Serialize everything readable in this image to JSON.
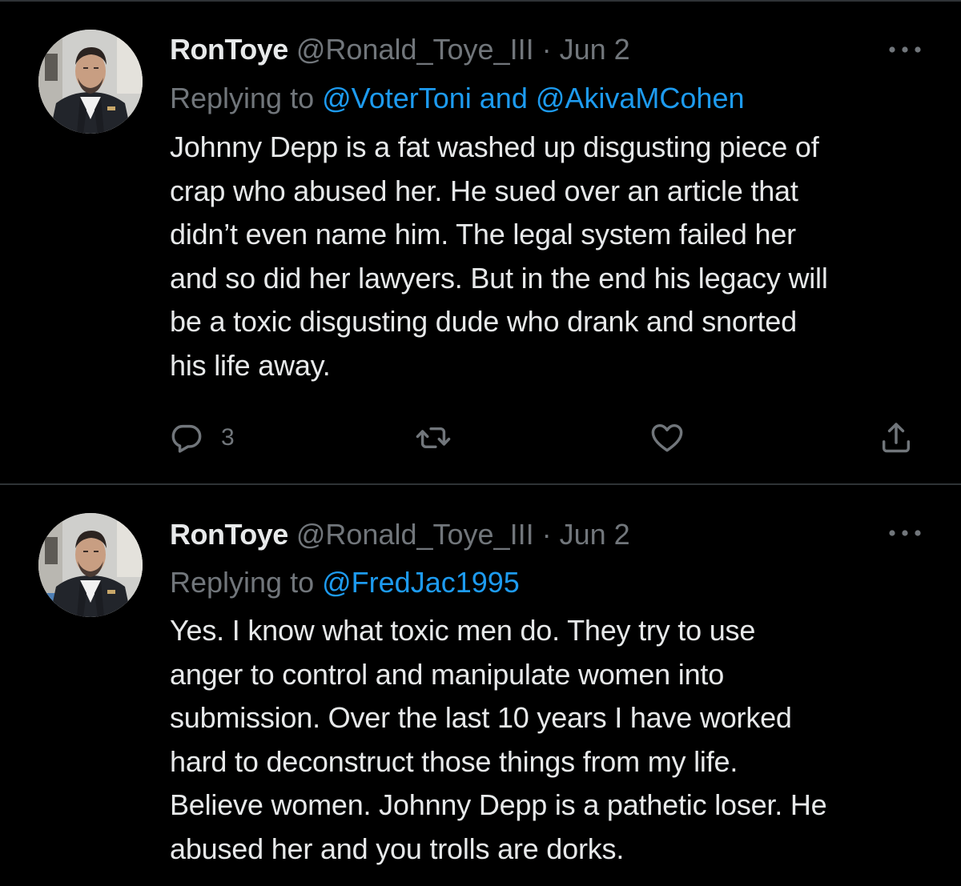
{
  "tweets": [
    {
      "display_name": "RonToye",
      "handle": "@Ronald_Toye_III",
      "separator": "·",
      "date": "Jun 2",
      "replying_prefix": "Replying to",
      "replying_mentions": "@VoterToni and @AkivaMCohen",
      "body_lines": [
        "Johnny Depp is a fat washed up disgusting piece of",
        "crap who abused her. He sued over an article that",
        "didn’t even name him. The legal system failed her",
        "and so did her lawyers. But in the end his legacy will",
        "be a toxic disgusting dude who drank and snorted",
        "his life away."
      ],
      "reply_count": "3",
      "icons": {
        "reply": "reply-icon",
        "retweet": "retweet-icon",
        "like": "heart-icon",
        "share": "share-icon",
        "more": "more-icon"
      }
    },
    {
      "display_name": "RonToye",
      "handle": "@Ronald_Toye_III",
      "separator": "·",
      "date": "Jun 2",
      "replying_prefix": "Replying to",
      "replying_mentions": "@FredJac1995",
      "body_lines": [
        "Yes. I know what toxic men do. They try to use",
        "anger to control and manipulate women into",
        "submission. Over the last 10 years I have worked",
        "hard to deconstruct those things from my life.",
        "Believe women. Johnny Depp is a pathetic loser. He",
        "abused her and you trolls are dorks."
      ]
    }
  ],
  "colors": {
    "background": "#000000",
    "text_primary": "#e7e9ea",
    "text_secondary": "#71767b",
    "accent_link": "#1d9bf0",
    "divider": "#2f3336"
  }
}
